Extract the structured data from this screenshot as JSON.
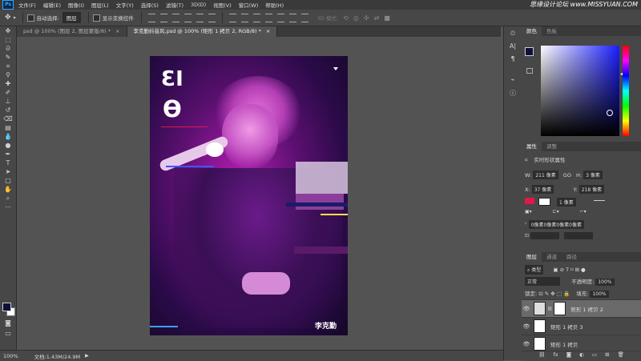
{
  "app": {
    "logo": "Ps"
  },
  "menu": [
    "文件(F)",
    "编辑(E)",
    "图像(I)",
    "图层(L)",
    "文字(Y)",
    "选择(S)",
    "滤镜(T)",
    "3D(D)",
    "视图(V)",
    "窗口(W)",
    "帮助(H)"
  ],
  "watermark": "思缘设计论坛 www.MISSYUAN.COM",
  "options": {
    "auto_select_label": "自动选择:",
    "auto_select_value": "图层",
    "show_transform_label": "显示变换控件",
    "mode_3d_label": "3D 模式:"
  },
  "tabs": [
    {
      "label": "psd @ 100% (图层 2, 图层蒙版/8) *",
      "close": "×"
    },
    {
      "label": "李克勤抖音风.psd @ 100% (矩形 1 拷贝 2, RGB/8) *",
      "close": "×"
    }
  ],
  "poster": {
    "glyph_top": "ƐI",
    "glyph_bottom": "ϴ",
    "signature": "李克勤"
  },
  "status": {
    "zoom": "100%",
    "doc": "文档:1.43M/24.9M"
  },
  "color_panel": {
    "tabs": [
      "颜色",
      "色板"
    ],
    "fg": "#0e0f3a"
  },
  "properties_panel": {
    "tabs": [
      "属性",
      "调整"
    ],
    "title": "实时形状属性",
    "w_label": "W:",
    "w_value": "211 像素",
    "link": "GO",
    "h_label": "H:",
    "h_value": "3 像素",
    "x_label": "X:",
    "x_value": "37 像素",
    "y_label": "Y:",
    "y_value": "218 像素",
    "fill_color": "#e0184a",
    "stroke_value": "1 像素",
    "corner_radius": "0像素0像素0像素0像素"
  },
  "layers_panel": {
    "tabs": [
      "图层",
      "通道",
      "路径"
    ],
    "filter_kind": "类型",
    "blend_mode": "正常",
    "opacity_label": "不透明度:",
    "opacity_value": "100%",
    "lock_label": "锁定:",
    "fill_label": "填充:",
    "fill_value": "100%",
    "layers": [
      {
        "name": "矩形 1 拷贝 2",
        "selected": true
      },
      {
        "name": "矩形 1 拷贝 3",
        "selected": false
      },
      {
        "name": "矩形 1 拷贝",
        "selected": false
      }
    ]
  }
}
